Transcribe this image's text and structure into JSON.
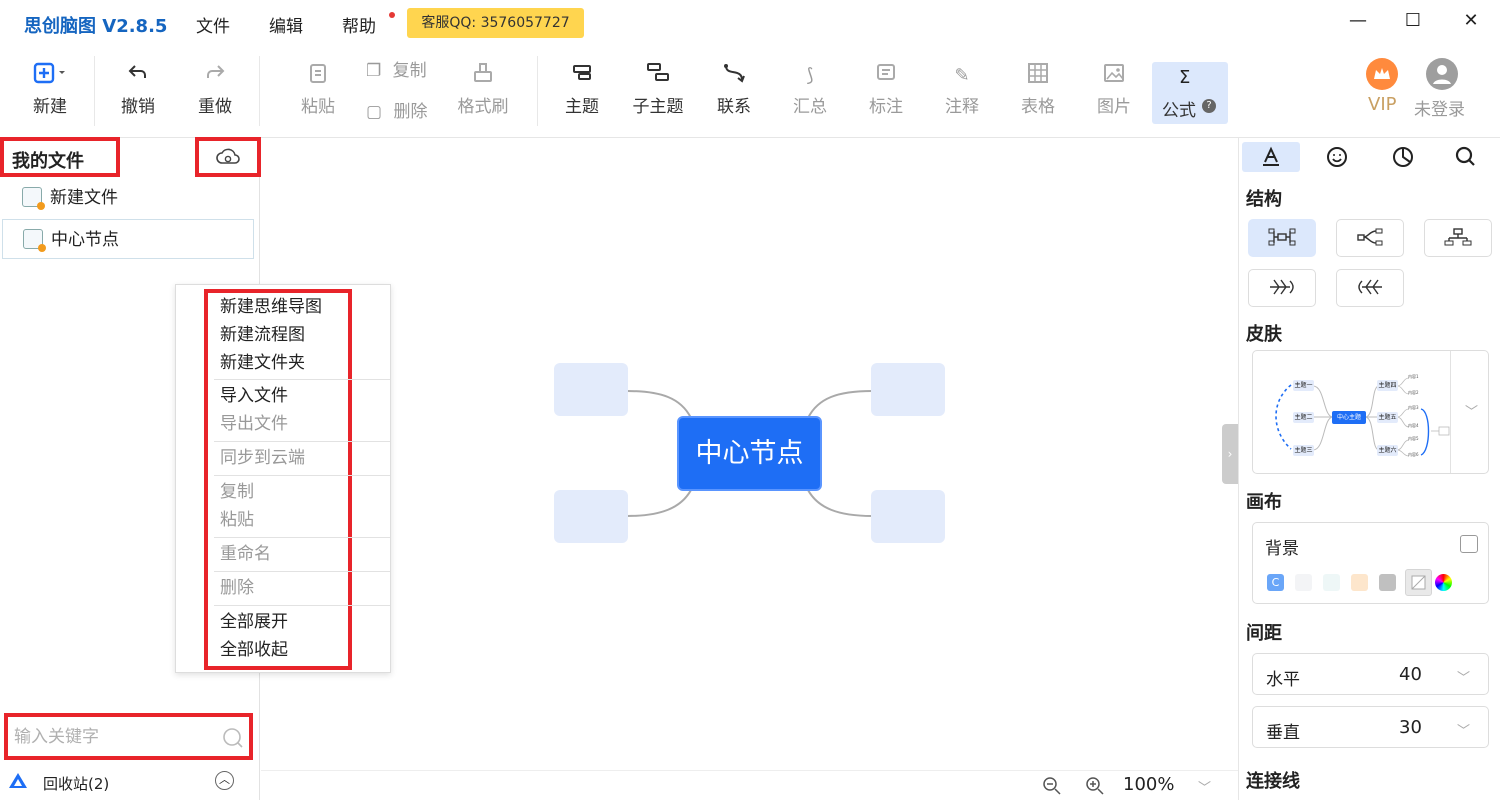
{
  "app": {
    "title": "思创脑图 V2.8.5",
    "qq_badge": "客服QQ: 3576057727"
  },
  "menu": {
    "file": "文件",
    "edit": "编辑",
    "help": "帮助"
  },
  "window_controls": {
    "minimize": "—",
    "maximize": "☐",
    "close": "✕"
  },
  "toolbar": {
    "new": "新建",
    "undo": "撤销",
    "redo": "重做",
    "paste": "粘贴",
    "copy": "复制",
    "delete": "删除",
    "format_brush": "格式刷",
    "topic": "主题",
    "subtopic": "子主题",
    "relation": "联系",
    "summary": "汇总",
    "label": "标注",
    "note": "注释",
    "table": "表格",
    "image": "图片",
    "formula": "公式",
    "vip": "VIP",
    "login": "未登录"
  },
  "sidebar": {
    "title": "我的文件",
    "files": [
      {
        "name": "新建文件"
      },
      {
        "name": "中心节点"
      }
    ],
    "search_placeholder": "输入关键字",
    "recycle": "回收站(2)"
  },
  "context_menu": {
    "items": [
      {
        "label": "新建思维导图",
        "enabled": true
      },
      {
        "label": "新建流程图",
        "enabled": true
      },
      {
        "label": "新建文件夹",
        "enabled": true
      },
      {
        "label": "导入文件",
        "enabled": true
      },
      {
        "label": "导出文件",
        "enabled": false
      },
      {
        "label": "同步到云端",
        "enabled": false
      },
      {
        "label": "复制",
        "enabled": false
      },
      {
        "label": "粘贴",
        "enabled": false
      },
      {
        "label": "重命名",
        "enabled": false
      },
      {
        "label": "删除",
        "enabled": false
      },
      {
        "label": "全部展开",
        "enabled": true
      },
      {
        "label": "全部收起",
        "enabled": true
      }
    ]
  },
  "canvas": {
    "center_node": "中心节点",
    "zoom": "100%"
  },
  "right_panel": {
    "structure": "结构",
    "skin": "皮肤",
    "skin_preview": {
      "center": "中心主题",
      "left": [
        "主题一",
        "主题二",
        "主题三"
      ],
      "right": [
        "主题四",
        "主题五",
        "主题六"
      ],
      "leaves": [
        "内容1",
        "内容2",
        "内容3",
        "内容4",
        "内容5",
        "内容6"
      ]
    },
    "canvas_title": "画布",
    "background": "背景",
    "spacing": "间距",
    "horizontal_label": "水平",
    "horizontal_value": "40",
    "vertical_label": "垂直",
    "vertical_value": "30",
    "connector": "连接线"
  },
  "colors": {
    "accent": "#1e6ef5",
    "highlight": "#e8242a",
    "node_fill": "#e3ebfb",
    "swatches": [
      "#6aa6f8",
      "#f3f4f6",
      "#eef7f7",
      "#fde6cc",
      "#c0c0c0",
      "#e9e9e9"
    ]
  }
}
